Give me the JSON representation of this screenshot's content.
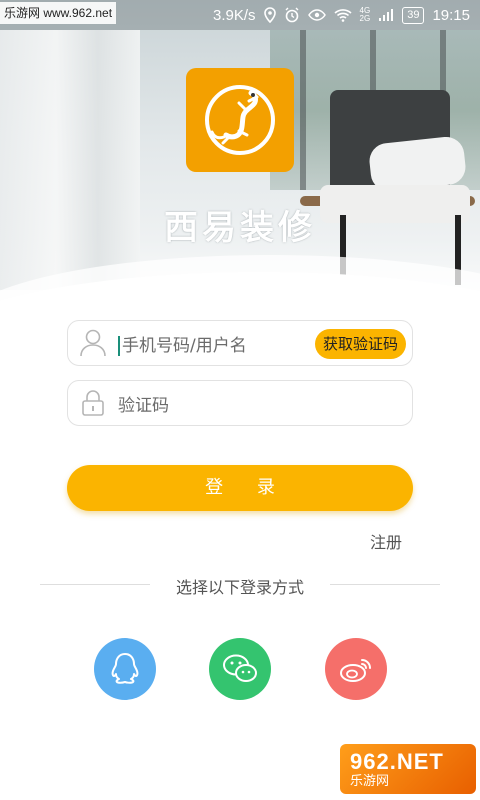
{
  "status_bar": {
    "speed": "3.9K/s",
    "network_top": "4G",
    "network_bottom": "2G",
    "battery": "39",
    "time": "19:15"
  },
  "watermark_top": "乐游网 www.962.net",
  "brand": {
    "name": "西易装修"
  },
  "form": {
    "username_placeholder": "手机号码/用户名",
    "get_code_label": "获取验证码",
    "code_placeholder": "验证码",
    "login_label": "登 录",
    "register_label": "注册"
  },
  "divider_text": "选择以下登录方式",
  "social": {
    "items": [
      {
        "icon": "qq-icon",
        "color": "#5aaef0"
      },
      {
        "icon": "wechat-icon",
        "color": "#34c46f"
      },
      {
        "icon": "weibo-icon",
        "color": "#f56f6a"
      }
    ]
  },
  "colors": {
    "accent": "#fbb400",
    "logo_bg": "#f3a000"
  },
  "watermark_bottom": {
    "number": "962.NET",
    "text": "乐游网"
  }
}
